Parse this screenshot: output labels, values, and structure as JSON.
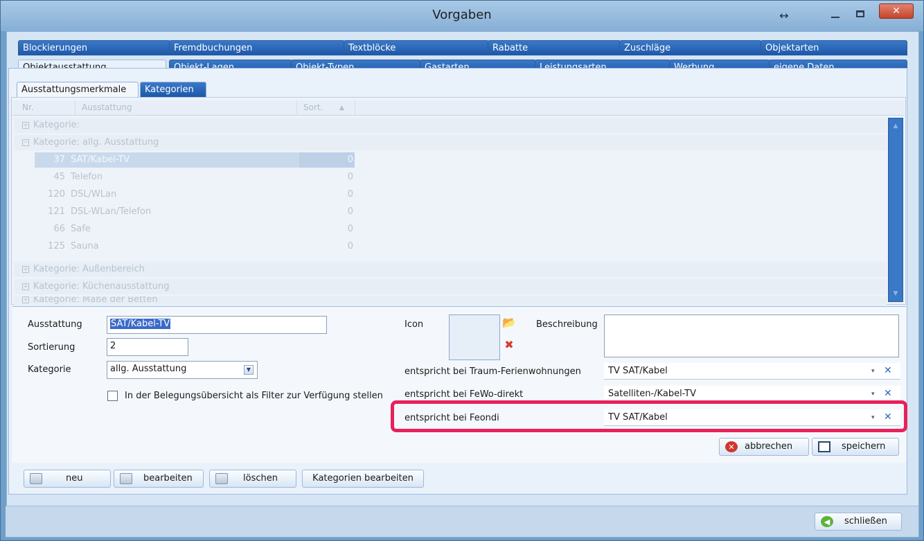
{
  "window": {
    "title": "Vorgaben",
    "resize_glyph": "↔",
    "close_glyph": "✕"
  },
  "tabs_row1": [
    "Blockierungen",
    "Fremdbuchungen",
    "Textblöcke",
    "Rabatte",
    "Zuschläge",
    "Objektarten"
  ],
  "tabs_row2": [
    "Objektausstattung",
    "Objekt-Lagen",
    "Objekt-Typen",
    "Gastarten",
    "Leistungsarten",
    "Werbung",
    "eigene Daten"
  ],
  "subtabs": [
    "Ausstattungsmerkmale",
    "Kategorien"
  ],
  "grid": {
    "columns": {
      "nr": "Nr.",
      "ausstattung": "Ausstattung",
      "sort": "Sort.",
      "sort_icon": "▲"
    },
    "group_rows": [
      "Kategorie:",
      "Kategorie: allg. Ausstattung",
      "Kategorie: Außenbereich",
      "Kategorie: Küchenausstattung",
      "Kategorie: Maße der Betten"
    ],
    "rows": [
      {
        "nr": "37",
        "name": "SAT/Kabel-TV",
        "sort": "0"
      },
      {
        "nr": "45",
        "name": "Telefon",
        "sort": "0"
      },
      {
        "nr": "120",
        "name": "DSL/WLan",
        "sort": "0"
      },
      {
        "nr": "121",
        "name": "DSL-WLan/Telefon",
        "sort": "0"
      },
      {
        "nr": "66",
        "name": "Safe",
        "sort": "0"
      },
      {
        "nr": "125",
        "name": "Sauna",
        "sort": "0"
      }
    ]
  },
  "form": {
    "ausstattung_label": "Ausstattung",
    "ausstattung_value": "SAT/Kabel-TV",
    "sortierung_label": "Sortierung",
    "sortierung_value": "2",
    "kategorie_label": "Kategorie",
    "kategorie_value": "allg. Ausstattung",
    "filter_checkbox_label": "In der Belegungsübersicht als Filter zur Verfügung stellen",
    "icon_label": "Icon",
    "beschreibung_label": "Beschreibung",
    "beschreibung_value": "",
    "traum_label": "entspricht bei Traum-Ferienwohnungen",
    "traum_value": "TV SAT/Kabel",
    "fewo_label": "entspricht bei FeWo-direkt",
    "fewo_value": "Satelliten-/Kabel-TV",
    "feondi_label": "entspricht bei Feondi",
    "feondi_value": "TV SAT/Kabel",
    "dropdown_glyph": "▾",
    "clear_glyph": "✕"
  },
  "buttons": {
    "abbrechen": "abbrechen",
    "speichern": "speichern",
    "neu": "neu",
    "bearbeiten": "bearbeiten",
    "loeschen": "löschen",
    "kategorien_bearbeiten": "Kategorien bearbeiten",
    "schliessen": "schließen"
  },
  "colors": {
    "tab_blue": "#1e57a8",
    "highlight": "#e8215a",
    "selection": "#3a6ac8"
  }
}
